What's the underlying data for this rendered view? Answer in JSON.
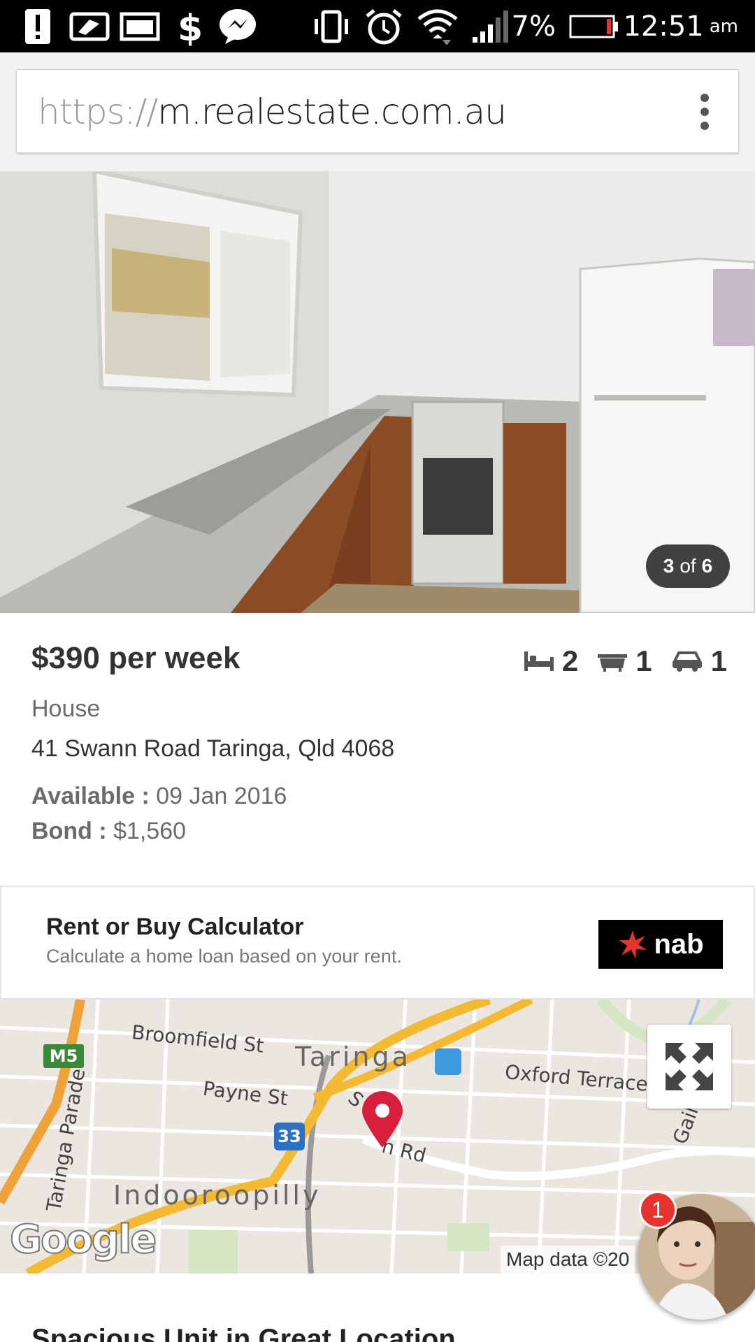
{
  "status_bar": {
    "notification_icons": [
      "alert-icon",
      "news-icon",
      "gallery-icon",
      "dollar-app-icon",
      "messenger-icon"
    ],
    "system_icons": [
      "vibrate-icon",
      "alarm-icon",
      "wifi-icon",
      "signal-icon"
    ],
    "battery_percent": "7%",
    "time": "12:51",
    "ampm": "am"
  },
  "browser": {
    "url_scheme": "https://",
    "url_host": "m.realestate.com.au",
    "menu_icon": "overflow-menu-icon"
  },
  "gallery": {
    "current": "3",
    "of": "of",
    "total": "6"
  },
  "listing": {
    "price": "$390 per week",
    "bedrooms": "2",
    "bathrooms": "1",
    "car_spaces": "1",
    "property_type": "House",
    "address": "41 Swann Road Taringa, Qld 4068",
    "available_label": "Available :",
    "available_value": "09 Jan 2016",
    "bond_label": "Bond :",
    "bond_value": "$1,560"
  },
  "calculator": {
    "title": "Rent or Buy Calculator",
    "subtitle": "Calculate a home loan based on your rent.",
    "sponsor": "nab"
  },
  "map": {
    "labels": {
      "broomfield": "Broomfield St",
      "taringa": "Taringa",
      "oxford": "Oxford Terrace",
      "payne": "Payne St",
      "swann": "n Rd",
      "swann_s": "S",
      "taringa_parade": "Taringa Parade",
      "indooroopilly": "Indooroopilly",
      "gailey": "Gailey",
      "m5": "M5",
      "route33": "33"
    },
    "attribution": "Map data ©20",
    "logo": "Google"
  },
  "chat_head": {
    "badge_count": "1"
  },
  "description": {
    "title": "Spacious Unit in Great Location"
  },
  "colors": {
    "status_bar": "#000000",
    "map_pin": "#d81e3a",
    "motorway": "#f5b932",
    "nab_star": "#e8322d"
  }
}
